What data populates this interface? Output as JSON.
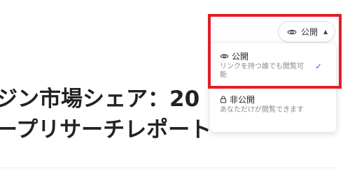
{
  "article": {
    "title_line1": "ジン市場シェア：20",
    "title_line2": "ープリサーチレポート"
  },
  "visibility": {
    "current_label": "公開",
    "caret": "▲",
    "options": [
      {
        "label": "公開",
        "description": "リンクを持つ誰でも閲覧可能",
        "selected": true,
        "icon": "eye-icon"
      },
      {
        "label": "非公開",
        "description": "あなただけが閲覧できます",
        "selected": false,
        "icon": "lock-icon"
      }
    ],
    "checkmark": "✓"
  },
  "colors": {
    "highlight": "#e01f26",
    "accent": "#3b6fd9"
  }
}
